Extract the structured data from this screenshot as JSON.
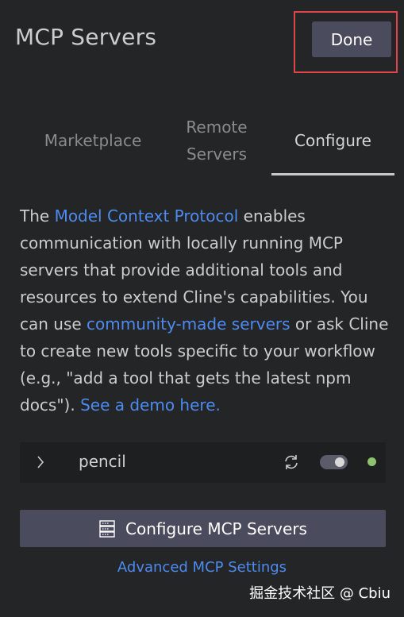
{
  "header": {
    "title": "MCP Servers",
    "done_label": "Done"
  },
  "tabs": [
    {
      "label": "Marketplace",
      "active": false
    },
    {
      "label_line1": "Remote",
      "label_line2": "Servers",
      "active": false
    },
    {
      "label": "Configure",
      "active": true
    }
  ],
  "description": {
    "part1": "The ",
    "link1": "Model Context Protocol",
    "part2": " enables communication with locally running MCP servers that provide additional tools and resources to extend Cline's capabilities. You can use ",
    "link2": "community-made servers",
    "part3": " or ask Cline to create new tools specific to your workflow (e.g., \"add a tool that gets the latest npm docs\"). ",
    "link3": "See a demo here."
  },
  "servers": [
    {
      "name": "pencil",
      "enabled": true,
      "status_color": "#8dc26f"
    }
  ],
  "configure_button_label": "Configure MCP Servers",
  "advanced_link_label": "Advanced MCP Settings",
  "watermark": "掘金技术社区 @ Cbiu",
  "colors": {
    "background": "#242526",
    "accent_link": "#4d8bf0",
    "button_bg": "#4a4c5e",
    "highlight_border": "#e0434a"
  }
}
